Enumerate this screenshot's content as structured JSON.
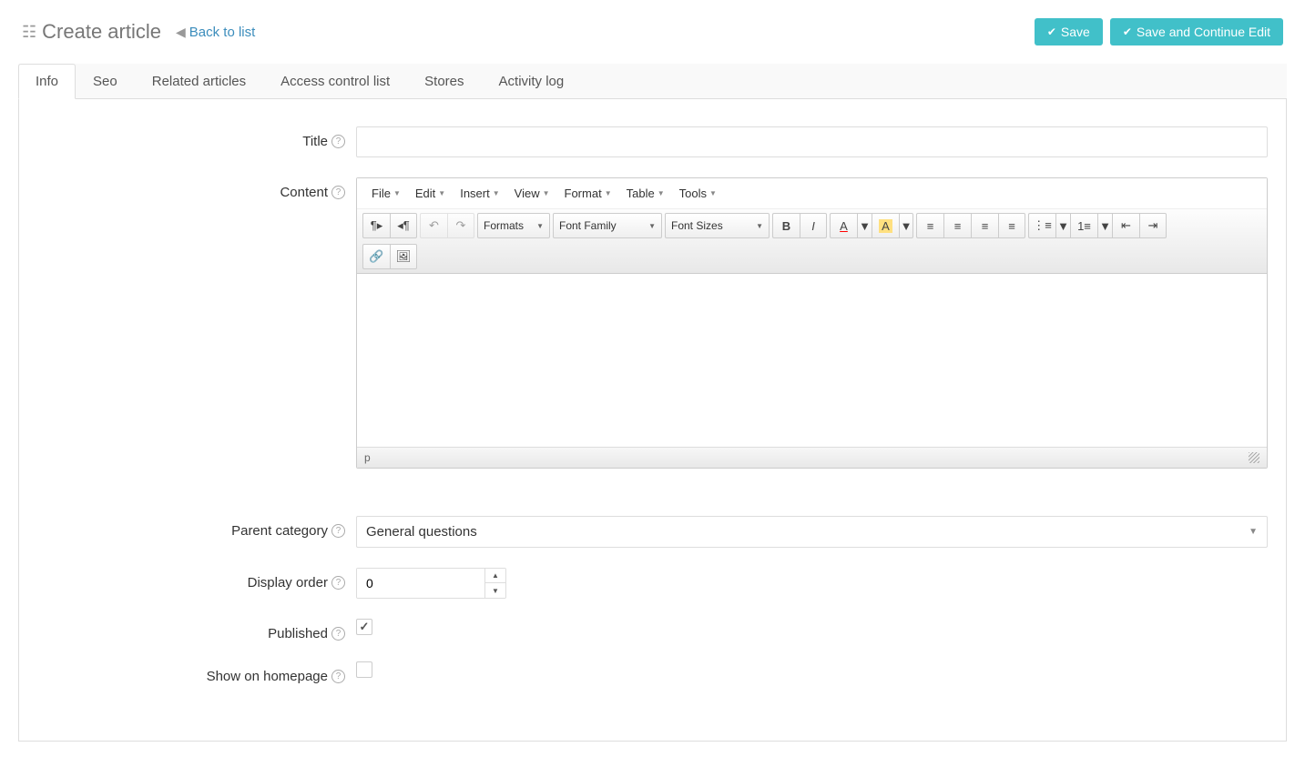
{
  "header": {
    "title": "Create article",
    "back_link": "Back to list",
    "save_btn": "Save",
    "save_continue_btn": "Save and Continue Edit"
  },
  "tabs": {
    "info": "Info",
    "seo": "Seo",
    "related": "Related articles",
    "acl": "Access control list",
    "stores": "Stores",
    "activity": "Activity log"
  },
  "form": {
    "title_label": "Title",
    "title_value": "",
    "content_label": "Content",
    "parent_label": "Parent category",
    "parent_value": "General questions",
    "display_order_label": "Display order",
    "display_order_value": "0",
    "published_label": "Published",
    "published_checked": true,
    "homepage_label": "Show on homepage",
    "homepage_checked": false
  },
  "editor": {
    "menu": {
      "file": "File",
      "edit": "Edit",
      "insert": "Insert",
      "view": "View",
      "format": "Format",
      "table": "Table",
      "tools": "Tools"
    },
    "toolbar": {
      "formats": "Formats",
      "font_family": "Font Family",
      "font_sizes": "Font Sizes"
    },
    "status_path": "p"
  }
}
